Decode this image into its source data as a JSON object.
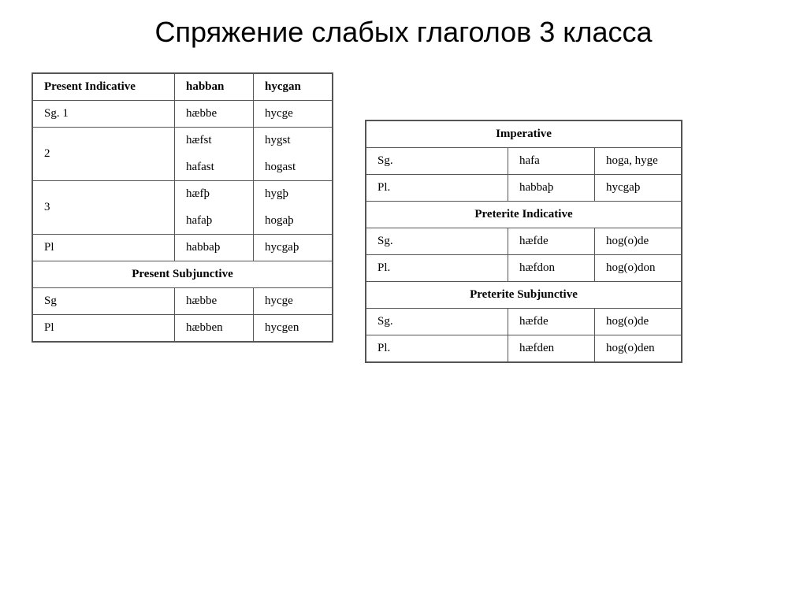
{
  "title": "Спряжение слабых глаголов 3 класса",
  "left_table": {
    "header": {
      "col1": "Present Indicative",
      "col2": "habban",
      "col3": "hycgan"
    },
    "rows": [
      {
        "label": "Sg. 1",
        "col2": "hæbbe",
        "col3": "hycge",
        "multiline": false
      },
      {
        "label": "2",
        "col2": "hæfst\n\nhafast",
        "col3": "hygst\n\nhogast",
        "multiline": true
      },
      {
        "label": "3",
        "col2": "hæfþ\n\nhafaþ",
        "col3": "hygþ\n\nhogaþ",
        "multiline": true
      },
      {
        "label": "Pl",
        "col2": "habbaþ",
        "col3": "hycgaþ",
        "multiline": false
      }
    ],
    "subjunctive_header": "Present Subjunctive",
    "subjunctive_rows": [
      {
        "label": "Sg",
        "col2": "hæbbe",
        "col3": "hycge"
      },
      {
        "label": "Pl",
        "col2": "hæbben",
        "col3": "hycgen"
      }
    ]
  },
  "right_table": {
    "imperative_header": "Imperative",
    "imperative_rows": [
      {
        "label": "Sg.",
        "col2": "hafa",
        "col3": "hoga, hyge"
      },
      {
        "label": "Pl.",
        "col2": "habbaþ",
        "col3": "hycgaþ"
      }
    ],
    "preterite_indicative_header": "Preterite Indicative",
    "preterite_indicative_rows": [
      {
        "label": "Sg.",
        "col2": "hæfde",
        "col3": "hog(o)de"
      },
      {
        "label": "Pl.",
        "col2": "hæfdon",
        "col3": "hog(o)don"
      }
    ],
    "preterite_subjunctive_header": "Preterite Subjunctive",
    "preterite_subjunctive_rows": [
      {
        "label": "Sg.",
        "col2": "hæfde",
        "col3": "hog(o)de"
      },
      {
        "label": "Pl.",
        "col2": "hæfden",
        "col3": "hog(o)den"
      }
    ]
  }
}
